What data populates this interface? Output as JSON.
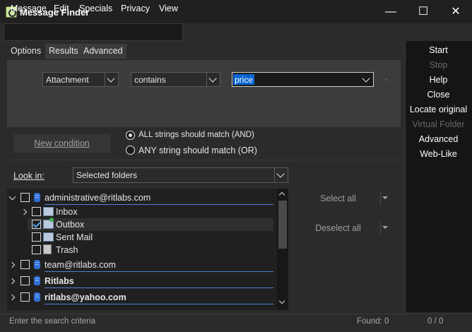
{
  "window": {
    "title": "Message Finder",
    "controls": {
      "minimize": "—",
      "maximize": "☐",
      "close": "✕"
    }
  },
  "menu": [
    "Message",
    "Edit",
    "Specials",
    "Privacy",
    "View"
  ],
  "tabs": [
    {
      "label": "Options",
      "active": true
    },
    {
      "label": "Results",
      "active": false
    },
    {
      "label": "Advanced",
      "active": false
    }
  ],
  "condition": {
    "field": "Attachment",
    "operator": "contains",
    "value": "price",
    "remove": "-"
  },
  "new_condition_button": "New condition",
  "match": {
    "all": "ALL strings should match (AND)",
    "any": "ANY string should match (OR)",
    "selected": "all"
  },
  "look_in": {
    "label": "Look in:",
    "value": "Selected folders"
  },
  "tree": [
    {
      "label": "administrative@ritlabs.com",
      "type": "account",
      "expanded": true,
      "checked": false,
      "bold": false,
      "indent": 0
    },
    {
      "label": "Inbox",
      "type": "folder",
      "expander": true,
      "checked": false,
      "indent": 1
    },
    {
      "label": "Outbox",
      "type": "folder",
      "expander": false,
      "checked": true,
      "indent": 1
    },
    {
      "label": "Sent Mail",
      "type": "folder",
      "expander": false,
      "checked": false,
      "indent": 1
    },
    {
      "label": "Trash",
      "type": "folder",
      "expander": false,
      "checked": false,
      "indent": 1
    },
    {
      "label": "team@ritlabs.com",
      "type": "account",
      "expanded": false,
      "checked": false,
      "bold": false,
      "indent": 0
    },
    {
      "label": "Ritlabs",
      "type": "account",
      "expanded": false,
      "checked": false,
      "bold": true,
      "indent": 0
    },
    {
      "label": "ritlabs@yahoo.com",
      "type": "account",
      "expanded": false,
      "checked": false,
      "bold": true,
      "indent": 0
    }
  ],
  "select_all": "Select all",
  "deselect_all": "Deselect all",
  "commands": [
    {
      "label": "Start",
      "enabled": true
    },
    {
      "label": "Stop",
      "enabled": false
    },
    {
      "label": "Help",
      "enabled": true
    },
    {
      "label": "Close",
      "enabled": true
    },
    {
      "label": "Locate original",
      "enabled": true
    },
    {
      "label": "Virtual Folder",
      "enabled": false
    },
    {
      "label": "Advanced",
      "enabled": true
    },
    {
      "label": "Web-Like",
      "enabled": true
    }
  ],
  "status": {
    "hint": "Enter the search criteria",
    "found": "Found: 0",
    "progress": "0 / 0"
  },
  "colors": {
    "accent": "#0a64d2",
    "background": "#2b2b2b",
    "panel": "#3c3c3c"
  }
}
